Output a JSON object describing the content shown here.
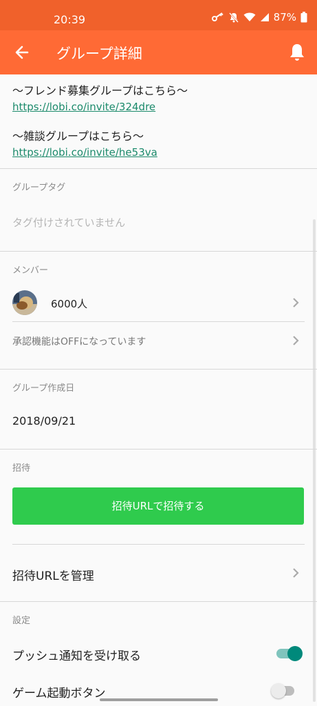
{
  "status_bar": {
    "time": "20:39",
    "battery": "87%"
  },
  "app_bar": {
    "title": "グループ詳細"
  },
  "description": {
    "friend_line": "〜フレンド募集グループはこちら〜",
    "friend_link": "https://lobi.co/invite/324dre",
    "chat_line": "〜雑談グループはこちら〜",
    "chat_link": "https://lobi.co/invite/he53va"
  },
  "tags": {
    "label": "グループタグ",
    "empty_text": "タグ付けされていません"
  },
  "members": {
    "label": "メンバー",
    "count": "6000人",
    "approval_status": "承認機能はOFFになっています"
  },
  "created": {
    "label": "グループ作成日",
    "date": "2018/09/21"
  },
  "invite": {
    "label": "招待",
    "button": "招待URLで招待する",
    "manage": "招待URLを管理"
  },
  "settings": {
    "label": "設定",
    "push": "プッシュ通知を受け取る",
    "push_on": true,
    "game": "ゲーム起動ボタン",
    "game_on": false
  },
  "colors": {
    "status_bar": "#f0612b",
    "app_bar": "#ff6a35",
    "invite_button": "#2fcb4d",
    "link": "#1b8a6b",
    "toggle_on": "#00897b"
  }
}
